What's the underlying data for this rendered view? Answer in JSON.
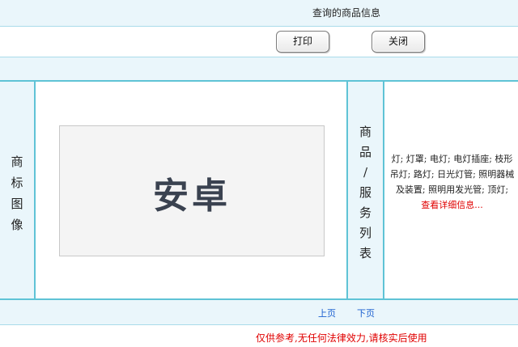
{
  "header": {
    "title": "查询的商品信息"
  },
  "toolbar": {
    "print_label": "打印",
    "close_label": "关闭"
  },
  "labels": {
    "trademark_image": [
      "商",
      "标",
      "图",
      "像"
    ],
    "goods_services": [
      "商",
      "品",
      "/",
      "服",
      "务",
      "列",
      "表"
    ]
  },
  "trademark": {
    "text": "安卓"
  },
  "goods": {
    "list": "灯; 灯罩; 电灯; 电灯插座; 枝形吊灯; 路灯; 日光灯管; 照明器械及装置; 照明用发光管; 顶灯;",
    "detail_link": "查看详细信息..."
  },
  "pager": {
    "prev_label": "上页",
    "next_label": "下页"
  },
  "footer": {
    "disclaimer": "仅供参考,无任何法律效力,请核实后使用"
  },
  "colors": {
    "band": "#eaf6fb",
    "border": "#5fc3d6",
    "alert": "#e00000",
    "link": "#1a5fd0"
  }
}
